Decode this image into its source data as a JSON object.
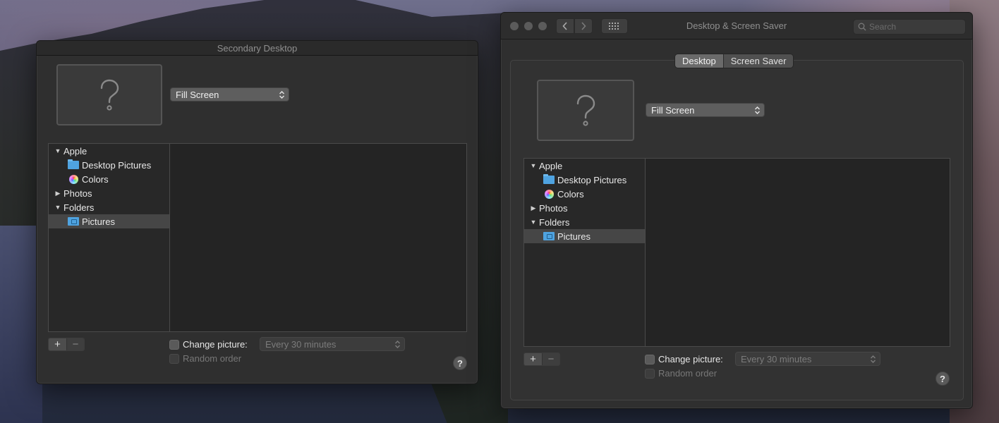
{
  "secondary_window": {
    "title": "Secondary Desktop",
    "fill_mode": "Fill Screen",
    "sources": [
      {
        "label": "Apple",
        "kind": "group",
        "expanded": true
      },
      {
        "label": "Desktop Pictures",
        "kind": "folder"
      },
      {
        "label": "Colors",
        "kind": "colors"
      },
      {
        "label": "Photos",
        "kind": "group",
        "expanded": false
      },
      {
        "label": "Folders",
        "kind": "group",
        "expanded": true
      },
      {
        "label": "Pictures",
        "kind": "pictures",
        "selected": true
      }
    ],
    "add_label": "+",
    "remove_label": "−",
    "change_picture_label": "Change picture:",
    "interval": "Every 30 minutes",
    "random_order_label": "Random order",
    "help_label": "?"
  },
  "main_window": {
    "title": "Desktop & Screen Saver",
    "search_placeholder": "Search",
    "tabs": [
      {
        "label": "Desktop",
        "active": true
      },
      {
        "label": "Screen Saver",
        "active": false
      }
    ],
    "fill_mode": "Fill Screen",
    "sources": [
      {
        "label": "Apple",
        "kind": "group",
        "expanded": true
      },
      {
        "label": "Desktop Pictures",
        "kind": "folder"
      },
      {
        "label": "Colors",
        "kind": "colors"
      },
      {
        "label": "Photos",
        "kind": "group",
        "expanded": false
      },
      {
        "label": "Folders",
        "kind": "group",
        "expanded": true
      },
      {
        "label": "Pictures",
        "kind": "pictures",
        "selected": true
      }
    ],
    "add_label": "+",
    "remove_label": "−",
    "change_picture_label": "Change picture:",
    "interval": "Every 30 minutes",
    "random_order_label": "Random order",
    "help_label": "?"
  }
}
